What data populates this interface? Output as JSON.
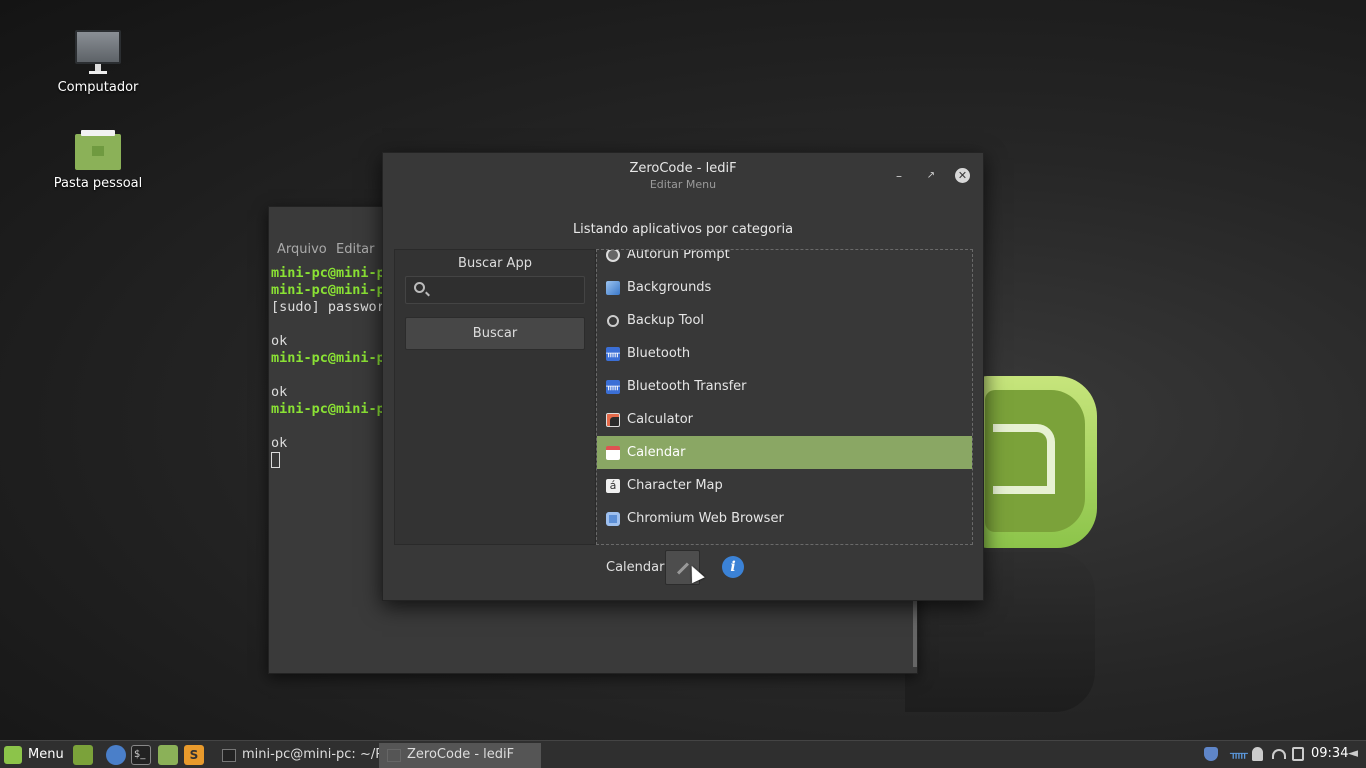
{
  "desktop": {
    "icons": [
      {
        "label": "Computador"
      },
      {
        "label": "Pasta pessoal"
      }
    ]
  },
  "terminal": {
    "menu": [
      "Arquivo",
      "Editar"
    ],
    "lines": [
      {
        "prompt": "mini-pc@mini-p",
        "text": ""
      },
      {
        "prompt": "mini-pc@mini-p",
        "text": ""
      },
      {
        "prompt": "",
        "text": "[sudo] passwor"
      },
      {
        "prompt": "",
        "text": ""
      },
      {
        "prompt": "",
        "text": "ok"
      },
      {
        "prompt": "mini-pc@mini-p",
        "text": ""
      },
      {
        "prompt": "",
        "text": ""
      },
      {
        "prompt": "",
        "text": "ok"
      },
      {
        "prompt": "mini-pc@mini-p",
        "text": ""
      },
      {
        "prompt": "",
        "text": ""
      },
      {
        "prompt": "",
        "text": "ok"
      }
    ]
  },
  "dialog": {
    "title": "ZeroCode - lediF",
    "subtitle": "Editar Menu",
    "heading": "Listando aplicativos por categoria",
    "search": {
      "label": "Buscar App",
      "placeholder": "",
      "value": "",
      "button": "Buscar"
    },
    "apps": [
      {
        "name": "Autorun Prompt",
        "icon": "gear-icon",
        "color": "#dddddd",
        "selected": false
      },
      {
        "name": "Backgrounds",
        "icon": "image-icon",
        "color": "#4a90d9",
        "selected": false
      },
      {
        "name": "Backup Tool",
        "icon": "refresh-icon",
        "color": "#cccccc",
        "selected": false
      },
      {
        "name": "Bluetooth",
        "icon": "bluetooth-icon",
        "color": "#3b6fd6",
        "selected": false
      },
      {
        "name": "Bluetooth Transfer",
        "icon": "bluetooth-icon",
        "color": "#3b6fd6",
        "selected": false
      },
      {
        "name": "Calculator",
        "icon": "calculator-icon",
        "color": "#e0e0e0",
        "selected": false
      },
      {
        "name": "Calendar",
        "icon": "calendar-icon",
        "color": "#e05252",
        "selected": true
      },
      {
        "name": "Character Map",
        "icon": "character-map-icon",
        "color": "#f0f0f0",
        "selected": false
      },
      {
        "name": "Chromium Web Browser",
        "icon": "chromium-icon",
        "color": "#5c8fd6",
        "selected": false
      }
    ],
    "selected_app": "Calendar",
    "info_glyph": "i"
  },
  "taskbar": {
    "menu_label": "Menu",
    "tasks": [
      {
        "label": "mini-pc@mini-pc: ~/P...",
        "active": false
      },
      {
        "label": "ZeroCode - lediF",
        "active": true
      }
    ],
    "clock": "09:34"
  },
  "colors": {
    "accent": "#8aa764",
    "prompt_green": "#8ae234",
    "info_blue": "#3b82d6"
  }
}
